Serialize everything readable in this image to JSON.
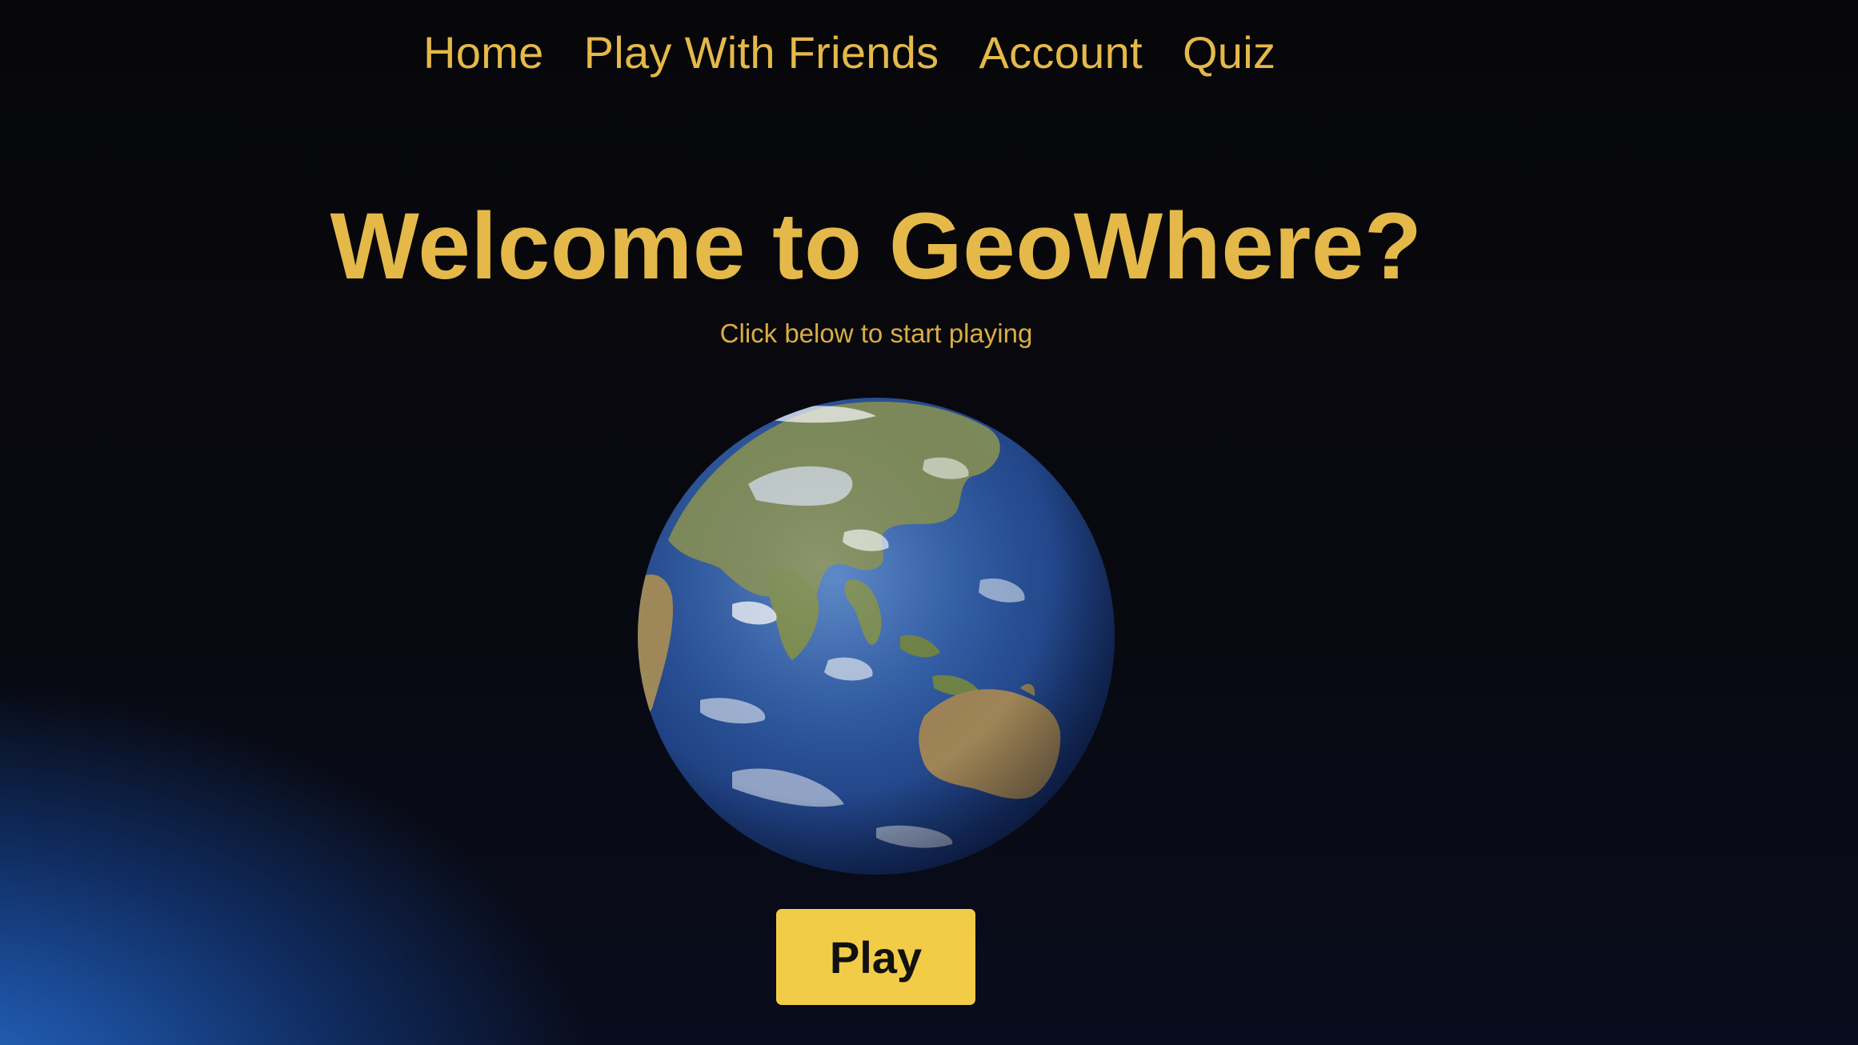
{
  "nav": {
    "items": [
      {
        "label": "Home"
      },
      {
        "label": "Play With Friends"
      },
      {
        "label": "Account"
      },
      {
        "label": "Quiz"
      }
    ]
  },
  "hero": {
    "title": "Welcome to GeoWhere?",
    "subtitle": "Click below to start playing"
  },
  "globe": {
    "icon": "earth-globe-icon"
  },
  "play_button": {
    "label": "Play"
  },
  "colors": {
    "accent_text": "#e4b94a",
    "button_bg": "#f2cc47",
    "button_text": "#111111",
    "background": "#07070a",
    "glow": "#2a6cc8"
  }
}
